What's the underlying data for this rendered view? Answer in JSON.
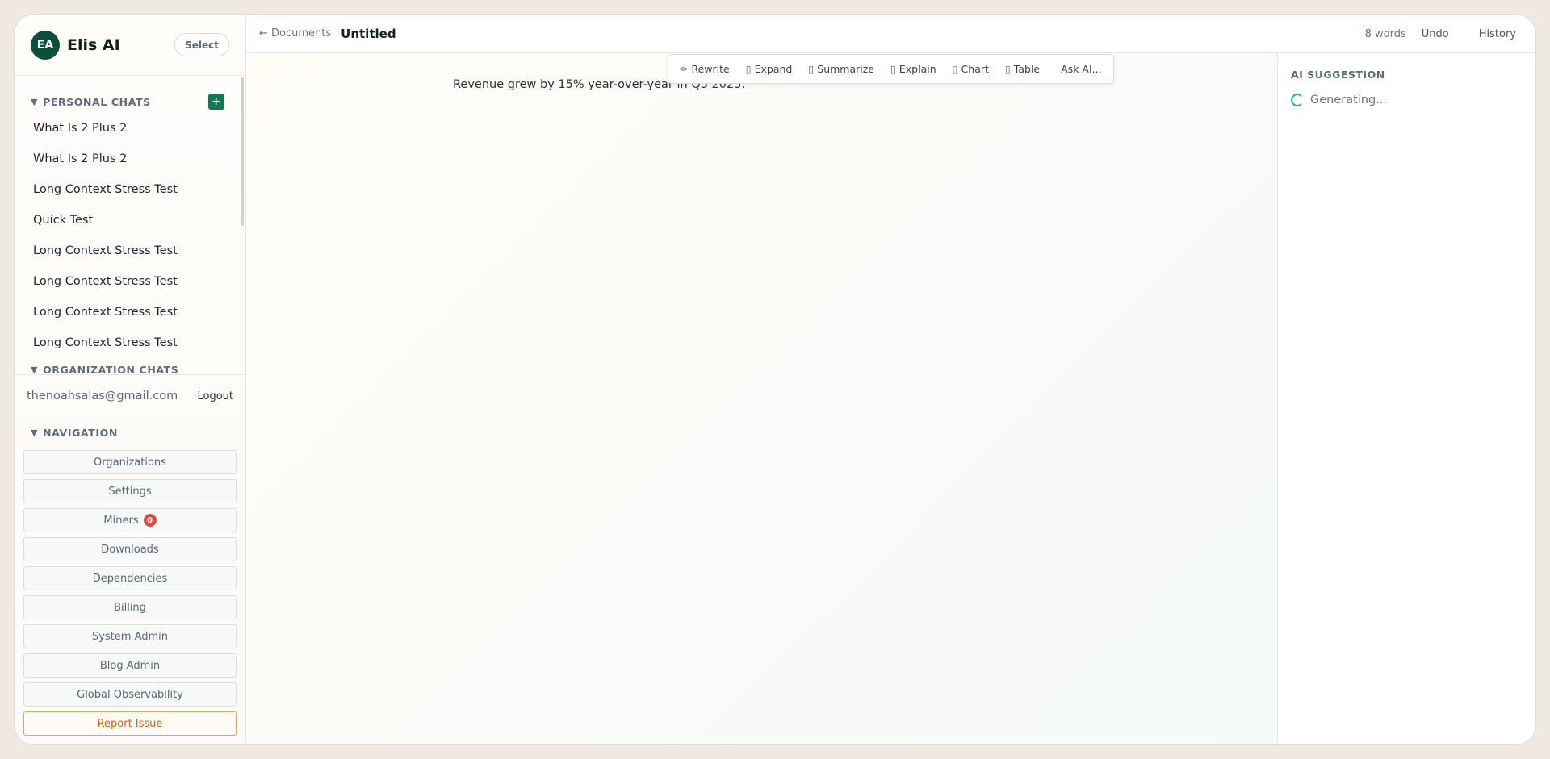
{
  "brand": {
    "initials": "EA",
    "name": "Elis AI",
    "select_label": "Select"
  },
  "personal_chats": {
    "title": "PERSONAL CHATS",
    "add_label": "+",
    "items": [
      "What Is 2 Plus 2",
      "What Is 2 Plus 2",
      "Long Context Stress Test",
      "Quick Test",
      "Long Context Stress Test",
      "Long Context Stress Test",
      "Long Context Stress Test",
      "Long Context Stress Test"
    ]
  },
  "organization_chats": {
    "title": "ORGANIZATION CHATS"
  },
  "user": {
    "email": "thenoahsalas@gmail.com",
    "logout_label": "Logout"
  },
  "navigation": {
    "title": "NAVIGATION",
    "items": [
      "Organizations",
      "Settings",
      "Miners",
      "Downloads",
      "Dependencies",
      "Billing",
      "System Admin",
      "Blog Admin",
      "Global Observability"
    ],
    "miners_badge": "0",
    "report_label": "Report Issue"
  },
  "topbar": {
    "back_label": "← Documents",
    "title": "Untitled",
    "word_count": "8 words",
    "undo_label": "Undo",
    "history_label": "History"
  },
  "toolbar": {
    "rewrite": "Rewrite",
    "expand": "Expand",
    "summarize": "Summarize",
    "explain": "Explain",
    "chart": "Chart",
    "table": "Table",
    "ask": "Ask AI...",
    "rewrite_glyph": "✏",
    "placeholder_glyph": "▯"
  },
  "editor": {
    "text": "Revenue grew by 15% year-over-year in Q3 2025."
  },
  "suggestion": {
    "title": "AI SUGGESTION",
    "status": "Generating..."
  },
  "colors": {
    "brand": "#0d4f3c",
    "accent": "#177653",
    "badge": "#e04848",
    "report": "#d4621a",
    "spinner": "#22b58a"
  }
}
